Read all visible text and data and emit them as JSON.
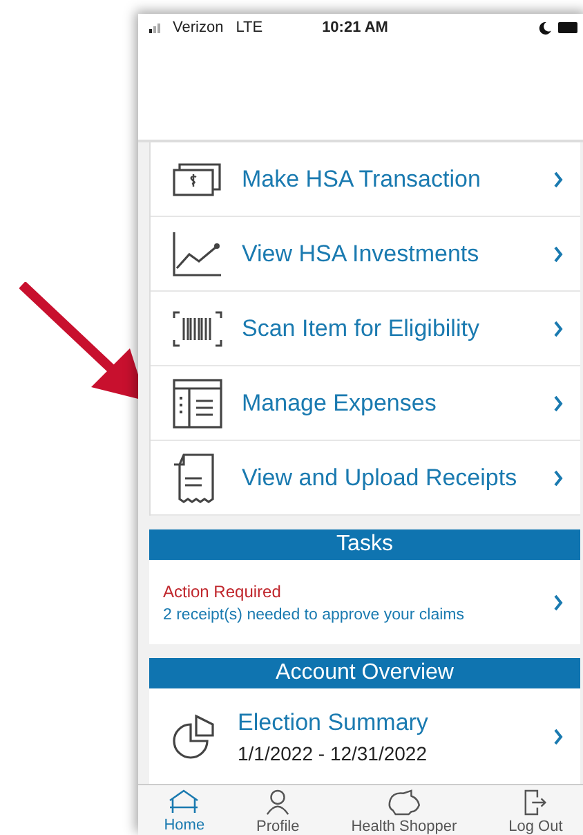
{
  "status_bar": {
    "carrier": "Verizon",
    "network": "LTE",
    "time": "10:21 AM"
  },
  "menu": [
    {
      "label": "Make HSA Transaction"
    },
    {
      "label": "View HSA Investments"
    },
    {
      "label": "Scan Item for Eligibility"
    },
    {
      "label": "Manage Expenses"
    },
    {
      "label": "View and Upload Receipts"
    }
  ],
  "tasks": {
    "title": "Tasks",
    "status": "Action Required",
    "message": "2 receipt(s) needed to approve your claims"
  },
  "account_overview": {
    "title": "Account Overview",
    "item": {
      "title": "Election Summary",
      "dates": "1/1/2022 - 12/31/2022"
    }
  },
  "tab_bar": [
    {
      "label": "Home",
      "selected": true
    },
    {
      "label": "Profile",
      "selected": false
    },
    {
      "label": "Health Shopper",
      "selected": false
    },
    {
      "label": "Log Out",
      "selected": false
    }
  ]
}
